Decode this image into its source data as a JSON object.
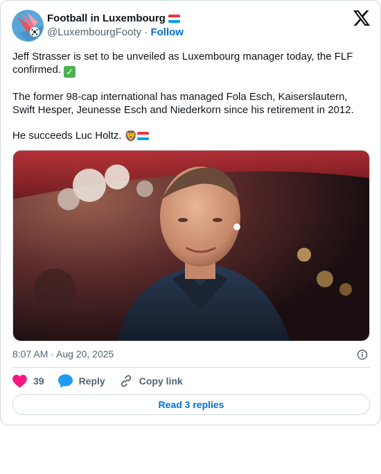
{
  "author": {
    "name": "Football in Luxembourg",
    "handle": "@LuxembourgFooty",
    "separator": "·",
    "follow_label": "Follow"
  },
  "icons": {
    "flag": "luxembourg-flag-icon",
    "platform": "x-logo-icon",
    "check": "check-mark-emoji",
    "lion": "lion-face-emoji",
    "info": "info-icon",
    "like": "heart-icon",
    "reply": "speech-bubble-icon",
    "copy": "link-icon"
  },
  "tweet": {
    "paragraph_1": "Jeff Strasser is set to be unveiled as Luxembourg manager today, the FLF confirmed.",
    "paragraph_2": "The former 98-cap international has managed Fola Esch, Kaiserslautern, Swift Hesper, Jeunesse Esch and Niederkorn since his retirement in 2012.",
    "paragraph_3": "He succeeds Luc Holtz.",
    "timestamp": "8:07 AM · Aug 20, 2025"
  },
  "actions": {
    "like_count": "39",
    "reply_label": "Reply",
    "copy_label": "Copy link"
  },
  "read_replies_label": "Read 3 replies",
  "colors": {
    "link_blue": "#006fd6",
    "like_pink": "#f91880",
    "reply_blue": "#1d9bf0",
    "flag_red": "#ef3340",
    "flag_blue": "#00a3e0"
  }
}
